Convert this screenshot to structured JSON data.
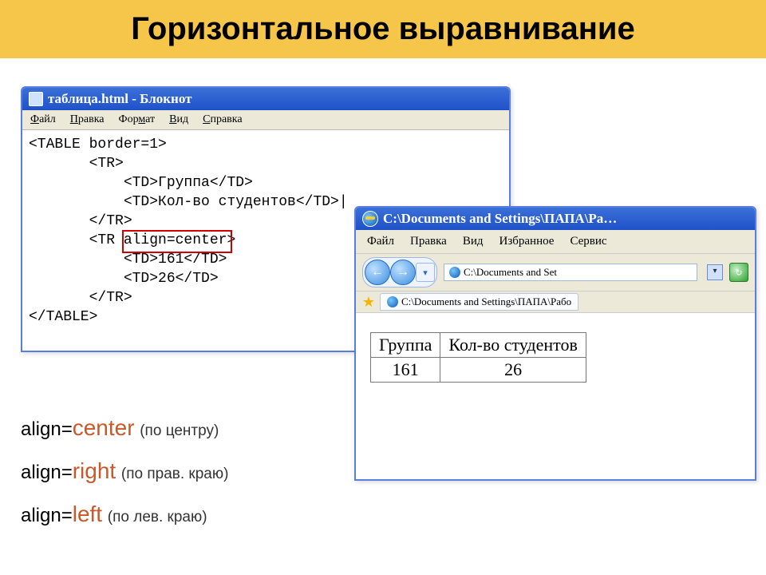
{
  "title": "Горизонтальное выравнивание",
  "notepad": {
    "window_title": "таблица.html - Блокнот",
    "menu": {
      "file": "Файл",
      "edit": "Правка",
      "format": "Формат",
      "view": "Вид",
      "help": "Справка"
    },
    "code": "<TABLE border=1>\n       <TR>\n           <TD>Группа</TD>\n           <TD>Кол-во студентов</TD>|\n       </TR>\n       <TR align=center>\n           <TD>161</TD>\n           <TD>26</TD>\n       </TR>\n</TABLE>",
    "highlight_text": "align=center"
  },
  "ie": {
    "window_title": "C:\\Documents and Settings\\ПАПА\\Ра…",
    "menu": {
      "file": "Файл",
      "edit": "Правка",
      "view": "Вид",
      "fav": "Избранное",
      "tools": "Сервис"
    },
    "address_short": "C:\\Documents and Set",
    "tab_label": "C:\\Documents and Settings\\ПАПА\\Рабо",
    "table": {
      "headers": [
        "Группа",
        "Кол-во студентов"
      ],
      "row": [
        "161",
        "26"
      ]
    }
  },
  "legend": {
    "center": {
      "prefix": "align=",
      "value": "center",
      "note": "(по центру)"
    },
    "right": {
      "prefix": "align=",
      "value": "right",
      "note": "(по прав. краю)"
    },
    "left": {
      "prefix": "align=",
      "value": "left",
      "note": "(по лев. краю)"
    }
  }
}
